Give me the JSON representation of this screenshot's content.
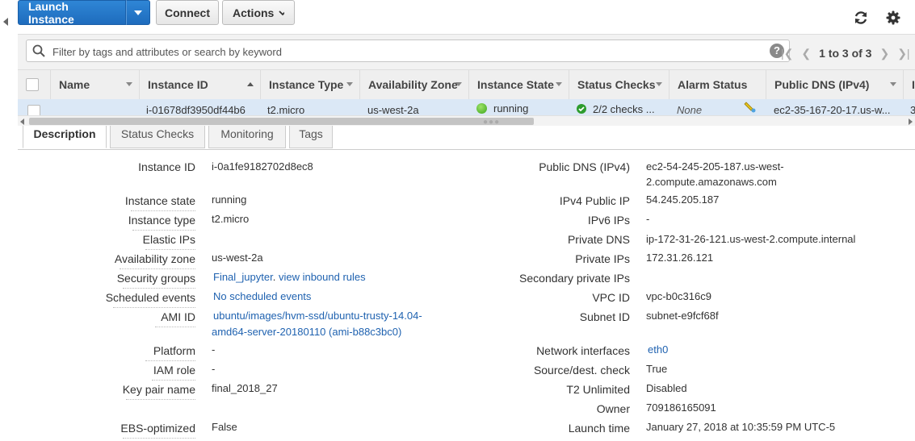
{
  "toolbar": {
    "launch_label": "Launch Instance",
    "connect_label": "Connect",
    "actions_label": "Actions"
  },
  "filter": {
    "placeholder": "Filter by tags and attributes or search by keyword",
    "help": "?",
    "pager_range": "1 to 3 of 3"
  },
  "table": {
    "columns": [
      "Name",
      "Instance ID",
      "Instance Type",
      "Availability Zone",
      "Instance State",
      "Status Checks",
      "Alarm Status",
      "Public DNS (IPv4)",
      "I"
    ],
    "row": {
      "instance_id": "i-01678df3950df44b6",
      "instance_type": "t2.micro",
      "zone": "us-west-2a",
      "state": "running",
      "status_checks": "2/2 checks ...",
      "alarm": "None",
      "dns": "ec2-35-167-20-17.us-w...",
      "extra": "3"
    }
  },
  "tabs": [
    "Description",
    "Status Checks",
    "Monitoring",
    "Tags"
  ],
  "left": [
    {
      "label": "Instance ID",
      "value": "i-0a1fe9182702d8ec8"
    },
    {
      "label": "Instance state",
      "value": "running"
    },
    {
      "label": "Instance type",
      "value": "t2.micro"
    },
    {
      "label": "Elastic IPs",
      "value": ""
    },
    {
      "label": "Availability zone",
      "value": "us-west-2a"
    },
    {
      "label": "Security groups",
      "value": "Final_jupyter",
      "value2": "view inbound rules"
    },
    {
      "label": "Scheduled events",
      "value": "No scheduled events"
    },
    {
      "label": "AMI ID",
      "value": "ubuntu/images/hvm-ssd/ubuntu-trusty-14.04-",
      "value2": "amd64-server-20180110 (ami-b88c3bc0)"
    },
    {
      "label": "Platform",
      "value": "-"
    },
    {
      "label": "IAM role",
      "value": "-"
    },
    {
      "label": "Key pair name",
      "value": "final_2018_27"
    },
    {
      "label": "EBS-optimized",
      "value": "False"
    }
  ],
  "right": [
    {
      "label": "Public DNS (IPv4)",
      "value": "ec2-54-245-205-187.us-west-",
      "value2": "2.compute.amazonaws.com"
    },
    {
      "label": "IPv4 Public IP",
      "value": "54.245.205.187"
    },
    {
      "label": "IPv6 IPs",
      "value": "-"
    },
    {
      "label": "Private DNS",
      "value": "ip-172-31-26-121.us-west-2.compute.internal"
    },
    {
      "label": "Private IPs",
      "value": "172.31.26.121"
    },
    {
      "label": "Secondary private IPs",
      "value": ""
    },
    {
      "label": "VPC ID",
      "value": "vpc-b0c316c9"
    },
    {
      "label": "Subnet ID",
      "value": "subnet-e9fcf68f"
    },
    {
      "label": "Network interfaces",
      "value": "eth0"
    },
    {
      "label": "Source/dest. check",
      "value": "True"
    },
    {
      "label": "T2 Unlimited",
      "value": "Disabled"
    },
    {
      "label": "Owner",
      "value": "709186165091"
    },
    {
      "label": "Launch time",
      "value": "January 27, 2018 at 10:35:59 PM UTC-5"
    }
  ]
}
